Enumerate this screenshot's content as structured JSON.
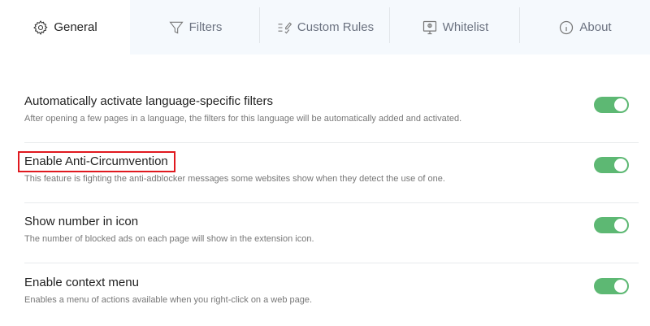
{
  "tabs": [
    {
      "label": "General",
      "icon": "gear-icon",
      "active": true
    },
    {
      "label": "Filters",
      "icon": "filter-icon"
    },
    {
      "label": "Custom Rules",
      "icon": "list-edit-icon"
    },
    {
      "label": "Whitelist",
      "icon": "monitor-icon"
    },
    {
      "label": "About",
      "icon": "info-icon"
    }
  ],
  "settings": [
    {
      "title": "Automatically activate language-specific filters",
      "description": "After opening a few pages in a language, the filters for this language will be automatically added and activated.",
      "enabled": true
    },
    {
      "title": "Enable Anti-Circumvention",
      "description": "This feature is fighting the anti-adblocker messages some websites show when they detect the use of one.",
      "enabled": true
    },
    {
      "title": "Show number in icon",
      "description": "The number of blocked ads on each page will show in the extension icon.",
      "enabled": true
    },
    {
      "title": "Enable context menu",
      "description": "Enables a menu of actions available when you right-click on a web page.",
      "enabled": true
    }
  ],
  "colors": {
    "toggle_on": "#5db873",
    "highlight": "#e0191f"
  }
}
